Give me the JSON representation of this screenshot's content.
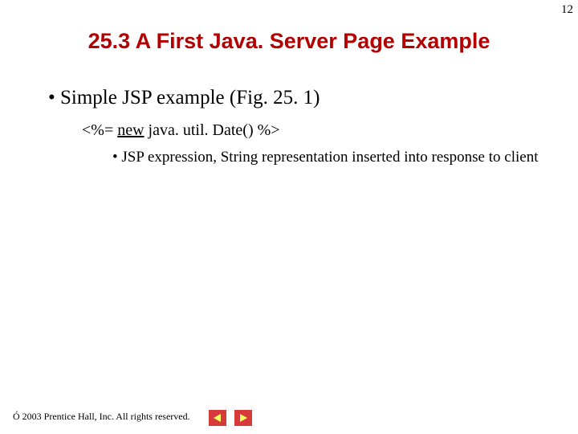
{
  "page_number": "12",
  "title": "25.3   A First Java. Server Page Example",
  "bullet1": "Simple JSP example (Fig. 25. 1)",
  "code_prefix": "<%= ",
  "code_underlined": "new",
  "code_suffix": " java. util. Date() %>",
  "bullet2": "JSP expression, String representation inserted into response to client",
  "footer_symbol": "Ó",
  "footer_text": " 2003 Prentice Hall, Inc. All rights reserved."
}
